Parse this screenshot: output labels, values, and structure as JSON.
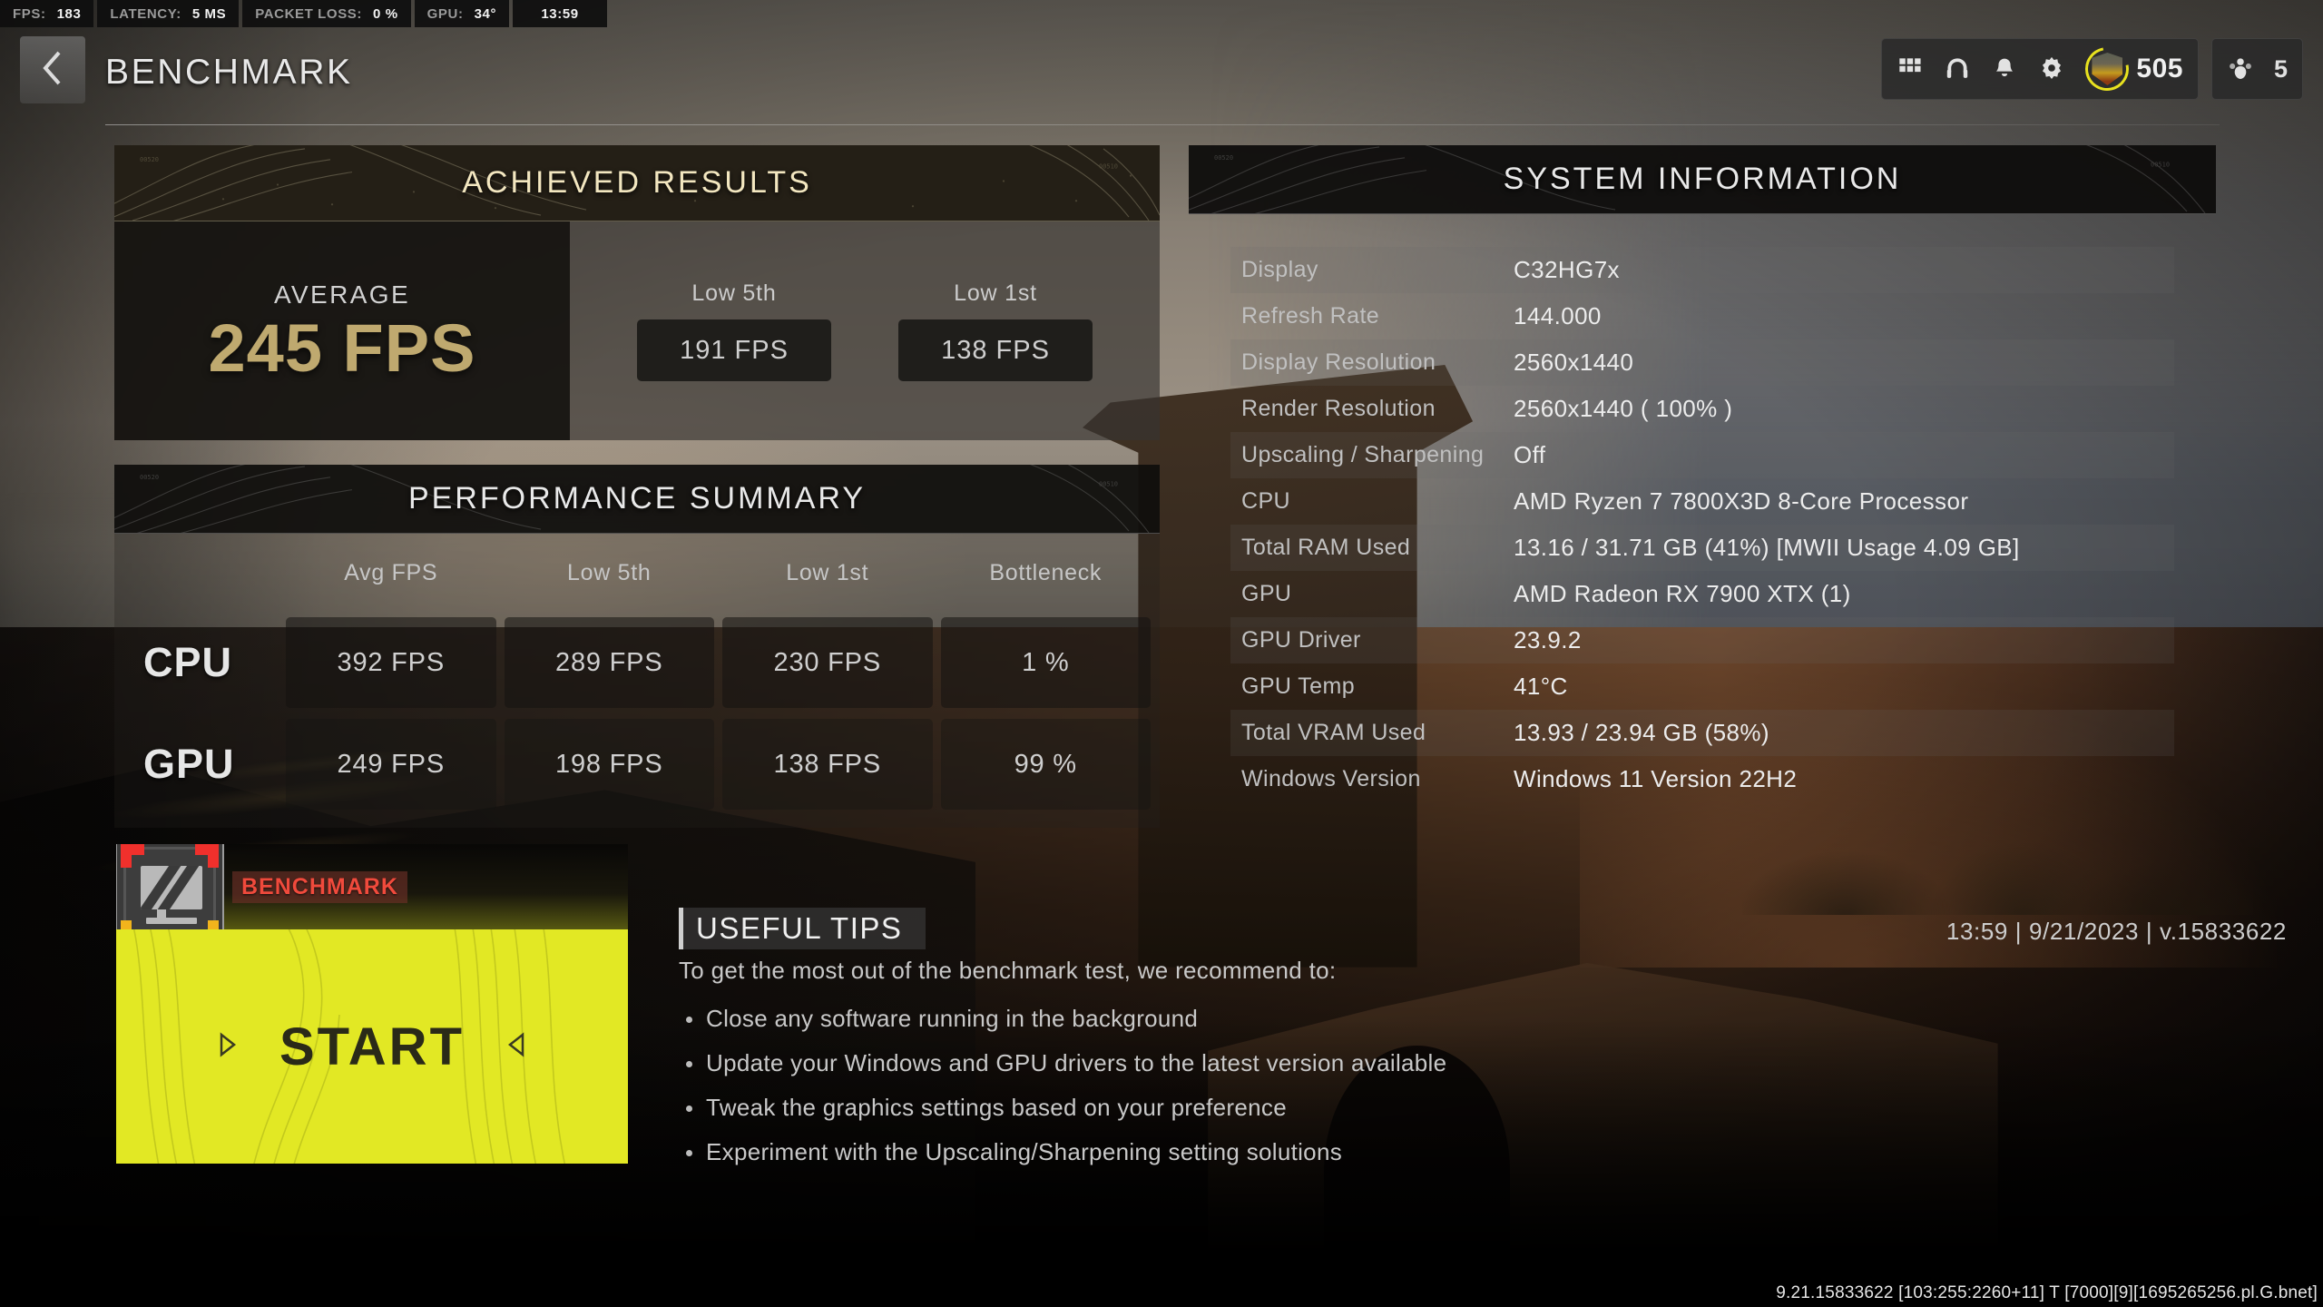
{
  "telemetry": [
    {
      "label": "FPS:",
      "value": "183"
    },
    {
      "label": "LATENCY:",
      "value": "5 MS"
    },
    {
      "label": "PACKET LOSS:",
      "value": "0 %"
    },
    {
      "label": "GPU:",
      "value": "34°"
    }
  ],
  "clock": "13:59",
  "header": {
    "title": "BENCHMARK",
    "back_icon": "chevron-left-icon",
    "icons": [
      "grid-icon",
      "headphones-icon",
      "bell-icon",
      "gear-icon"
    ],
    "rank_value": "505",
    "squad_count": "5",
    "rank_ring_color": "#e8e21f"
  },
  "achieved": {
    "title": "ACHIEVED RESULTS",
    "title_color": "#f3e7c0",
    "average_label": "AVERAGE",
    "average_value": "245 FPS",
    "average_color": "#bfa96f",
    "lows": [
      {
        "label": "Low 5th",
        "value": "191 FPS"
      },
      {
        "label": "Low 1st",
        "value": "138 FPS"
      }
    ]
  },
  "performance": {
    "title": "PERFORMANCE SUMMARY",
    "columns": [
      "Avg FPS",
      "Low 5th",
      "Low 1st",
      "Bottleneck"
    ],
    "rows": [
      {
        "name": "CPU",
        "cells": [
          "392 FPS",
          "289 FPS",
          "230 FPS",
          "1 %"
        ]
      },
      {
        "name": "GPU",
        "cells": [
          "249 FPS",
          "198 FPS",
          "138 FPS",
          "99 %"
        ]
      }
    ]
  },
  "system": {
    "title": "SYSTEM INFORMATION",
    "rows": [
      {
        "key": "Display",
        "value": "C32HG7x"
      },
      {
        "key": "Refresh Rate",
        "value": "144.000"
      },
      {
        "key": "Display Resolution",
        "value": "2560x1440"
      },
      {
        "key": "Render Resolution",
        "value": "2560x1440 ( 100% )"
      },
      {
        "key": "Upscaling / Sharpening",
        "value": "Off"
      },
      {
        "key": "CPU",
        "value": "AMD Ryzen 7 7800X3D 8-Core Processor"
      },
      {
        "key": "Total RAM Used",
        "value": "13.16 / 31.71 GB (41%) [MWII Usage 4.09 GB]"
      },
      {
        "key": "GPU",
        "value": "AMD Radeon RX 7900 XTX (1)"
      },
      {
        "key": "GPU Driver",
        "value": "23.9.2"
      },
      {
        "key": "GPU Temp",
        "value": "41°C"
      },
      {
        "key": "Total VRAM Used",
        "value": "13.93 / 23.94 GB (58%)"
      },
      {
        "key": "Windows Version",
        "value": "Windows 11 Version 22H2"
      }
    ]
  },
  "start": {
    "tag": "BENCHMARK",
    "tag_color": "#f04a3c",
    "label": "START",
    "button_color": "#e2e824",
    "thumb_icon": "monitor-benchmark-icon",
    "arrow_left_icon": "triangle-right-icon",
    "arrow_right_icon": "triangle-left-icon"
  },
  "tips": {
    "title": "USEFUL TIPS",
    "intro": "To get the most out of the benchmark test, we recommend to:",
    "items": [
      "Close any software running in the background",
      "Update your Windows and GPU drivers to the latest version available",
      "Tweak the graphics settings based on your preference",
      "Experiment with the Upscaling/Sharpening setting solutions"
    ]
  },
  "meta_line": "13:59 | 9/21/2023 | v.15833622",
  "build_string": "9.21.15833622 [103:255:2260+11] T [7000][9][1695265256.pl.G.bnet]"
}
